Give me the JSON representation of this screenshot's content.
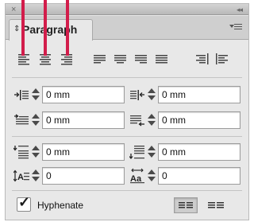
{
  "panel": {
    "title": "Paragraph",
    "close_glyph": "×",
    "collapse_glyph": "◂◂",
    "tab_arrows_glyph": "⇕",
    "menu_icon": "panel-menu-icon"
  },
  "alignment": {
    "buttons": [
      {
        "name": "align-left",
        "icon": "align-left-icon"
      },
      {
        "name": "align-center",
        "icon": "align-center-icon"
      },
      {
        "name": "align-right",
        "icon": "align-right-icon"
      },
      {
        "name": "justify-left",
        "icon": "justify-left-icon"
      },
      {
        "name": "justify-center",
        "icon": "justify-center-icon"
      },
      {
        "name": "justify-right",
        "icon": "justify-right-icon"
      },
      {
        "name": "justify-all",
        "icon": "justify-all-icon"
      },
      {
        "name": "align-toward-spine",
        "icon": "align-toward-spine-icon"
      },
      {
        "name": "align-away-from-spine",
        "icon": "align-away-from-spine-icon"
      }
    ]
  },
  "indents": {
    "left_indent": "0 mm",
    "right_indent": "0 mm",
    "first_line_indent": "0 mm",
    "last_line_right_indent": "0 mm"
  },
  "spacing": {
    "space_before": "0 mm",
    "space_after": "0 mm",
    "drop_cap_lines": "0",
    "drop_cap_characters": "0"
  },
  "hyphenate": {
    "label": "Hyphenate",
    "checked": true,
    "check_glyph": "✓"
  },
  "composers": {
    "active_index": 0
  },
  "annotation": {
    "marker_color": "#d21d4b"
  }
}
